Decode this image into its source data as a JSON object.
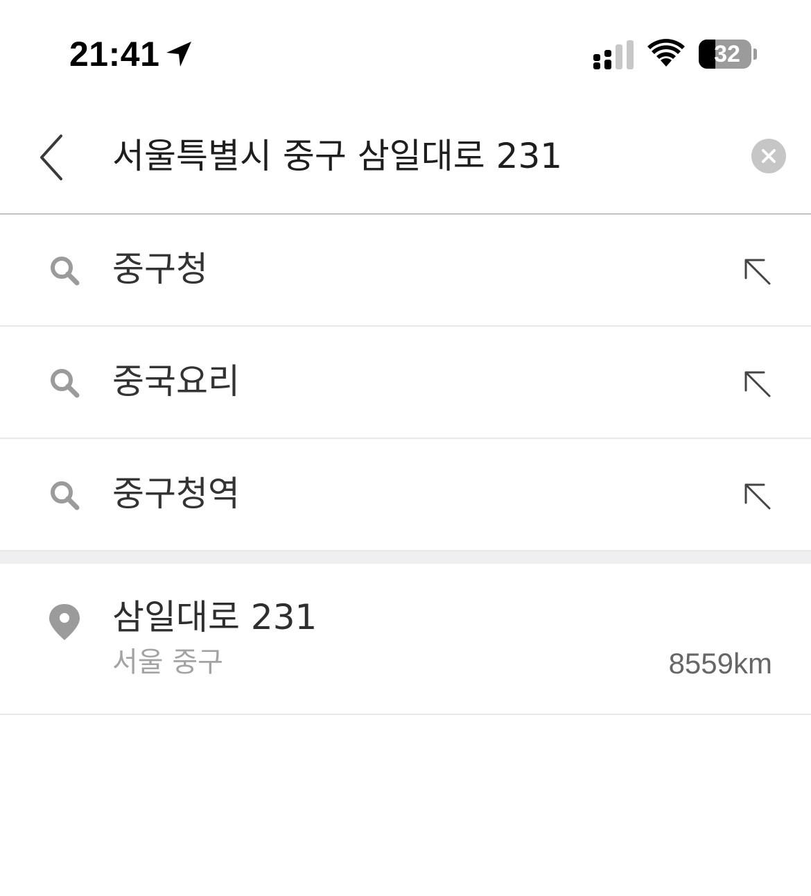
{
  "status_bar": {
    "time": "21:41",
    "battery_level": "32",
    "battery_percent": 32,
    "icons": [
      "location-arrow-icon",
      "cellular-signal-icon",
      "wifi-icon",
      "battery-icon"
    ]
  },
  "search": {
    "query": "서울특별시 중구 삼일대로 231",
    "back_icon": "chevron-left-icon",
    "clear_icon": "clear-circle-icon"
  },
  "suggestions": [
    {
      "text": "중구청",
      "icon": "search-icon",
      "action_icon": "fill-arrow-icon"
    },
    {
      "text": "중국요리",
      "icon": "search-icon",
      "action_icon": "fill-arrow-icon"
    },
    {
      "text": "중구청역",
      "icon": "search-icon",
      "action_icon": "fill-arrow-icon"
    }
  ],
  "place_result": {
    "name": "삼일대로 231",
    "region": "서울 중구",
    "distance": "8559km",
    "icon": "location-pin-icon"
  },
  "colors": {
    "icon_gray": "#9b9b9b",
    "secondary_text": "#a3a3a3",
    "divider": "#e8e8e8",
    "section_background": "#efeff1"
  }
}
